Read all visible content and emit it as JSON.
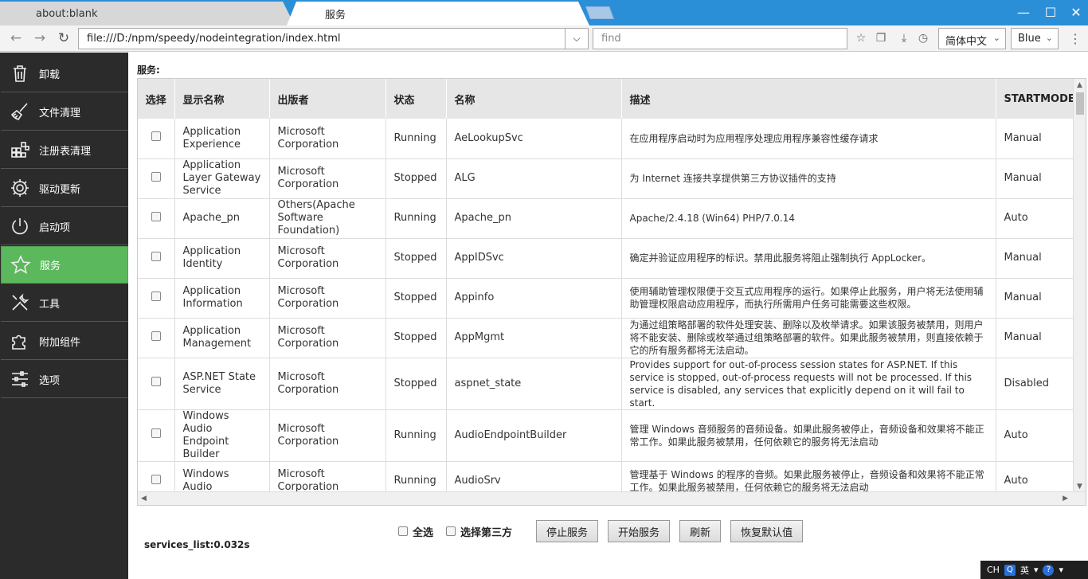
{
  "browser": {
    "tabs": [
      {
        "label": "about:blank"
      },
      {
        "label": "服务"
      }
    ],
    "url": "file:///D:/npm/speedy/nodeintegration/index.html",
    "find_placeholder": "find",
    "language": "简体中文",
    "theme": "Blue"
  },
  "sidebar": {
    "items": [
      {
        "label": "卸载",
        "icon": "trash-icon"
      },
      {
        "label": "文件清理",
        "icon": "broom-icon"
      },
      {
        "label": "注册表清理",
        "icon": "registry-icon"
      },
      {
        "label": "驱动更新",
        "icon": "gear-icon"
      },
      {
        "label": "启动项",
        "icon": "power-icon"
      },
      {
        "label": "服务",
        "icon": "star-icon"
      },
      {
        "label": "工具",
        "icon": "tools-icon"
      },
      {
        "label": "附加组件",
        "icon": "puzzle-icon"
      },
      {
        "label": "选项",
        "icon": "sliders-icon"
      }
    ],
    "active": "服务"
  },
  "main": {
    "title": "服务:",
    "columns": [
      "选择",
      "显示名称",
      "出版者",
      "状态",
      "名称",
      "描述",
      "STARTMODE"
    ],
    "rows": [
      {
        "display": "Application Experience",
        "publisher": "Microsoft Corporation",
        "status": "Running",
        "name": "AeLookupSvc",
        "desc": "在应用程序启动时为应用程序处理应用程序兼容性缓存请求",
        "mode": "Manual"
      },
      {
        "display": "Application Layer Gateway Service",
        "publisher": "Microsoft Corporation",
        "status": "Stopped",
        "name": "ALG",
        "desc": "为 Internet 连接共享提供第三方协议插件的支持",
        "mode": "Manual"
      },
      {
        "display": "Apache_pn",
        "publisher": "Others(Apache Software Foundation)",
        "status": "Running",
        "name": "Apache_pn",
        "desc": "Apache/2.4.18 (Win64) PHP/7.0.14",
        "mode": "Auto"
      },
      {
        "display": "Application Identity",
        "publisher": "Microsoft Corporation",
        "status": "Stopped",
        "name": "AppIDSvc",
        "desc": "确定并验证应用程序的标识。禁用此服务将阻止强制执行 AppLocker。",
        "mode": "Manual"
      },
      {
        "display": "Application Information",
        "publisher": "Microsoft Corporation",
        "status": "Stopped",
        "name": "Appinfo",
        "desc": "使用辅助管理权限便于交互式应用程序的运行。如果停止此服务，用户将无法使用辅助管理权限启动应用程序，而执行所需用户任务可能需要这些权限。",
        "mode": "Manual"
      },
      {
        "display": "Application Management",
        "publisher": "Microsoft Corporation",
        "status": "Stopped",
        "name": "AppMgmt",
        "desc": "为通过组策略部署的软件处理安装、删除以及枚举请求。如果该服务被禁用，则用户将不能安装、删除或枚举通过组策略部署的软件。如果此服务被禁用，则直接依赖于它的所有服务都将无法启动。",
        "mode": "Manual"
      },
      {
        "display": "ASP.NET State Service",
        "publisher": "Microsoft Corporation",
        "status": "Stopped",
        "name": "aspnet_state",
        "desc": "Provides support for out-of-process session states for ASP.NET. If this service is stopped, out-of-process requests will not be processed. If this service is disabled, any services that explicitly depend on it will fail to start.",
        "mode": "Disabled"
      },
      {
        "display": "Windows Audio Endpoint Builder",
        "publisher": "Microsoft Corporation",
        "status": "Running",
        "name": "AudioEndpointBuilder",
        "desc": "管理 Windows 音频服务的音频设备。如果此服务被停止，音频设备和效果将不能正常工作。如果此服务被禁用，任何依赖它的服务将无法启动",
        "mode": "Auto"
      },
      {
        "display": "Windows Audio",
        "publisher": "Microsoft Corporation",
        "status": "Running",
        "name": "AudioSrv",
        "desc": "管理基于 Windows 的程序的音频。如果此服务被停止，音频设备和效果将不能正常工作。如果此服务被禁用，任何依赖它的服务将无法启动",
        "mode": "Auto"
      }
    ]
  },
  "footer": {
    "select_all": "全选",
    "select_third_party": "选择第三方",
    "buttons": [
      "停止服务",
      "开始服务",
      "刷新",
      "恢复默认值"
    ],
    "timing": "services_list:0.032s"
  },
  "tray": {
    "ch": "CH",
    "lang": "英"
  }
}
